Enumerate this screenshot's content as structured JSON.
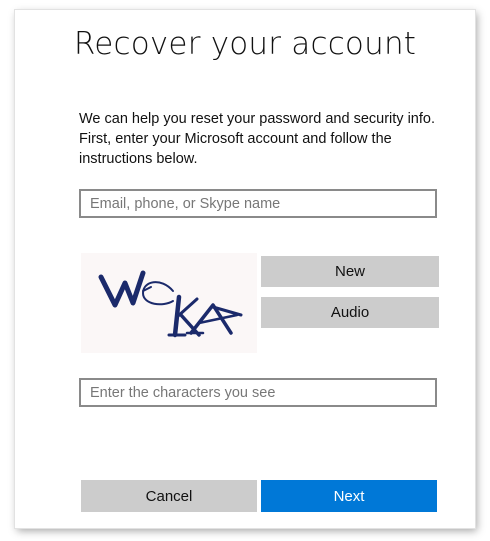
{
  "dialog": {
    "title": "Recover your account",
    "instructions": "We can help you reset your password and security info. First, enter your Microsoft account and follow the instructions below."
  },
  "email_field": {
    "value": "",
    "placeholder": "Email, phone, or Skype name"
  },
  "captcha": {
    "image_text": "WCKA",
    "new_label": "New",
    "audio_label": "Audio"
  },
  "captcha_field": {
    "value": "",
    "placeholder": "Enter the characters you see"
  },
  "actions": {
    "cancel_label": "Cancel",
    "next_label": "Next"
  },
  "colors": {
    "accent": "#0078d7",
    "secondary_button": "#cccccc",
    "field_border": "#8a8a8a",
    "captcha_ink": "#1b2a6b"
  }
}
